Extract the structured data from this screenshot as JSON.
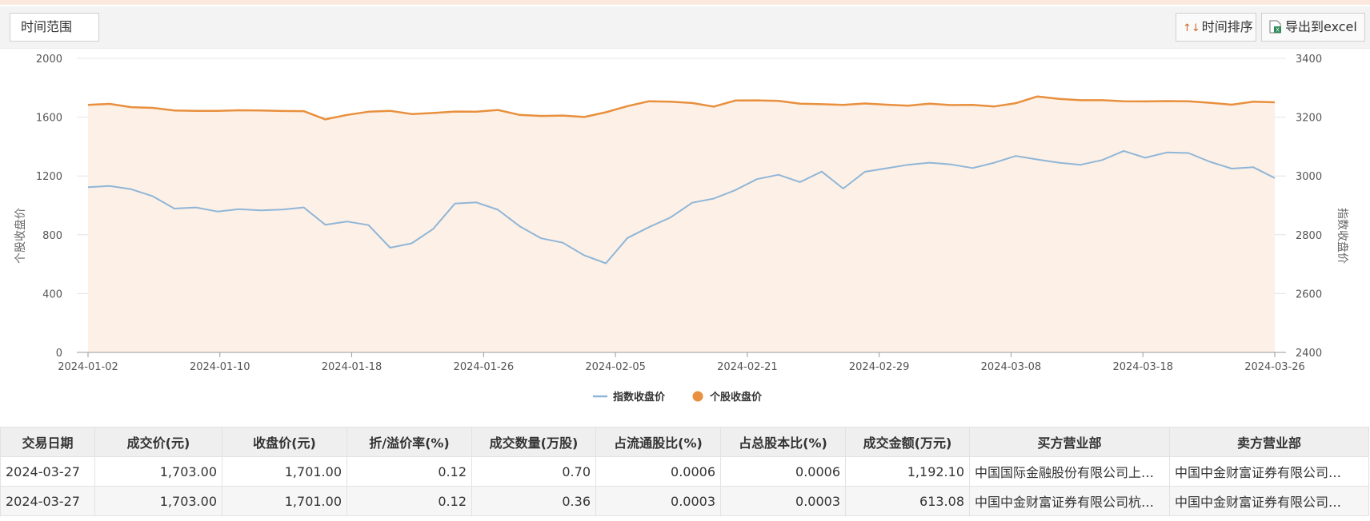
{
  "toolbar": {
    "time_range_label": "时间范围",
    "sort_label": "时间排序",
    "sort_icon": "↑↓",
    "export_label": "导出到excel",
    "colors": {
      "accent": "#d06a2a",
      "excel_icon": "#2e8b57"
    }
  },
  "chart_data": {
    "type": "line",
    "title": "",
    "x_labels": [
      "2024-01-02",
      "2024-01-10",
      "2024-01-18",
      "2024-01-26",
      "2024-02-05",
      "2024-02-21",
      "2024-02-29",
      "2024-03-08",
      "2024-03-18",
      "2024-03-26"
    ],
    "left_axis": {
      "label": "个股收盘价",
      "min": 0,
      "max": 2000,
      "ticks": [
        0,
        400,
        800,
        1200,
        1600,
        2000
      ]
    },
    "right_axis": {
      "label": "指数收盘价",
      "min": 2400,
      "max": 3400,
      "ticks": [
        2400,
        2600,
        2800,
        3000,
        3200,
        3400
      ]
    },
    "grid": true,
    "legend_position": "bottom-center",
    "series": [
      {
        "name": "指数收盘价",
        "axis": "right",
        "color": "#8fb6d8",
        "values": [
          2962,
          2966,
          2955,
          2931,
          2889,
          2893,
          2879,
          2887,
          2883,
          2886,
          2893,
          2834,
          2845,
          2833,
          2756,
          2771,
          2820,
          2906,
          2910,
          2885,
          2829,
          2788,
          2773,
          2730,
          2703,
          2789,
          2826,
          2859,
          2909,
          2923,
          2952,
          2989,
          3004,
          2979,
          3015,
          2957,
          3014,
          3026,
          3038,
          3045,
          3039,
          3027,
          3045,
          3068,
          3056,
          3045,
          3038,
          3054,
          3085,
          3062,
          3080,
          3078,
          3048,
          3025,
          3030,
          2993
        ]
      },
      {
        "name": "个股收盘价",
        "axis": "left",
        "color": "#e8903e",
        "fill": "#fdf0e6",
        "values": [
          1683,
          1690,
          1668,
          1663,
          1645,
          1643,
          1643,
          1647,
          1645,
          1642,
          1641,
          1585,
          1615,
          1637,
          1643,
          1621,
          1628,
          1638,
          1637,
          1649,
          1615,
          1608,
          1611,
          1601,
          1633,
          1675,
          1708,
          1705,
          1696,
          1672,
          1713,
          1714,
          1711,
          1692,
          1688,
          1683,
          1693,
          1685,
          1678,
          1692,
          1682,
          1683,
          1673,
          1695,
          1741,
          1724,
          1715,
          1715,
          1708,
          1707,
          1709,
          1708,
          1698,
          1685,
          1705,
          1701
        ]
      }
    ]
  },
  "table": {
    "columns": [
      "交易日期",
      "成交价(元)",
      "收盘价(元)",
      "折/溢价率(%)",
      "成交数量(万股)",
      "占流通股比(%)",
      "占总股本比(%)",
      "成交金额(万元)",
      "买方营业部",
      "卖方营业部"
    ],
    "rows": [
      [
        "2024-03-27",
        "1,703.00",
        "1,701.00",
        "0.12",
        "0.70",
        "0.0006",
        "0.0006",
        "1,192.10",
        "中国国际金融股份有限公司上…",
        "中国中金财富证券有限公司…"
      ],
      [
        "2024-03-27",
        "1,703.00",
        "1,701.00",
        "0.12",
        "0.36",
        "0.0003",
        "0.0003",
        "613.08",
        "中国中金财富证券有限公司杭…",
        "中国中金财富证券有限公司…"
      ]
    ]
  }
}
